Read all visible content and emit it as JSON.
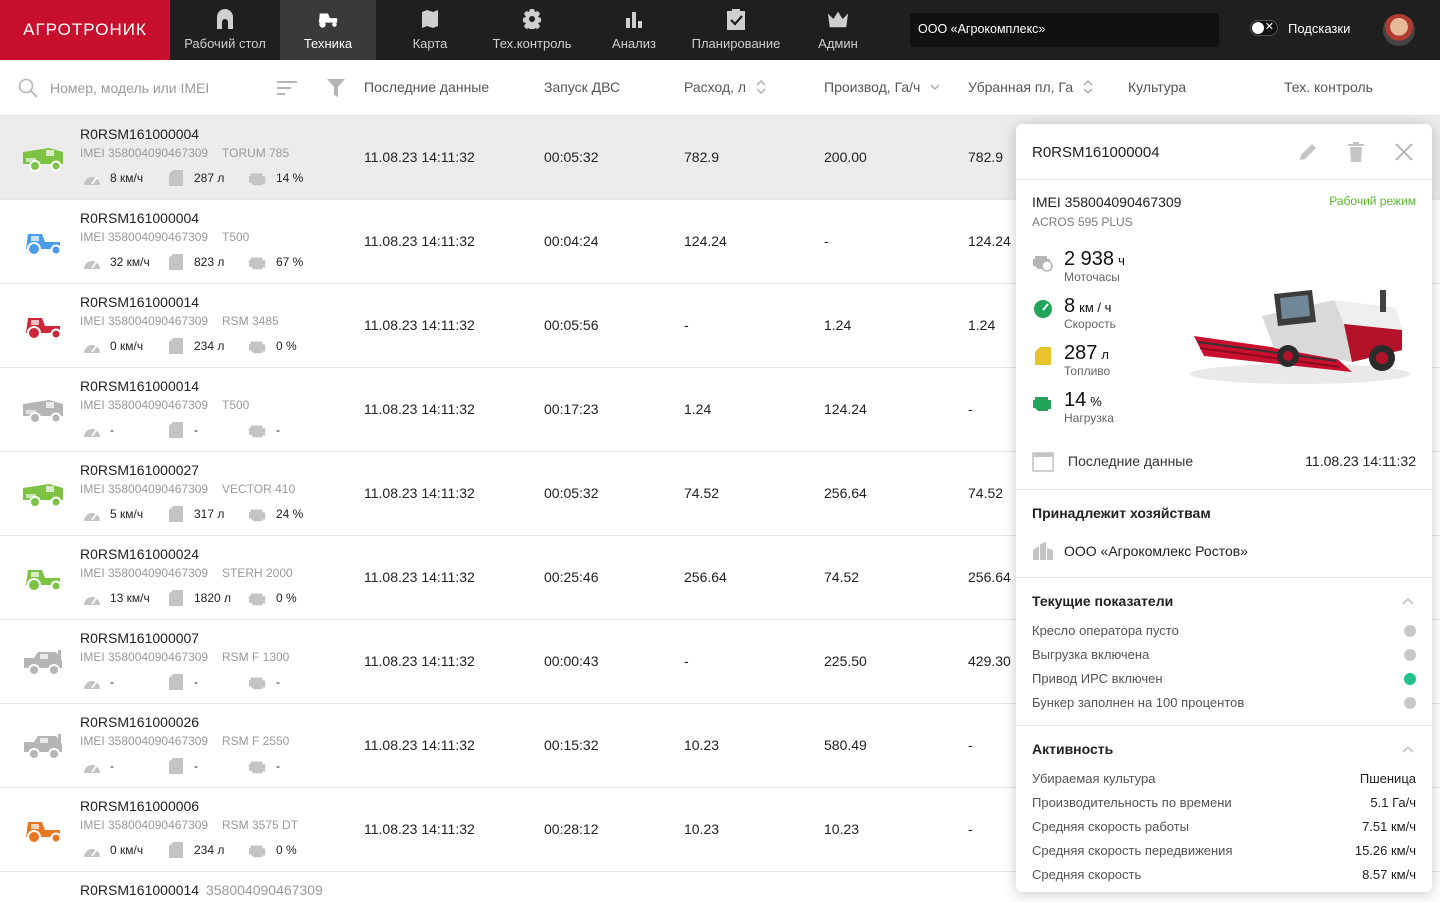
{
  "app": {
    "logo": "АГРОТРОНИК",
    "nav": [
      {
        "label": "Рабочий стол",
        "icon": "home-icon"
      },
      {
        "label": "Техника",
        "icon": "tractor-icon",
        "active": true
      },
      {
        "label": "Карта",
        "icon": "map-icon"
      },
      {
        "label": "Тех.контроль",
        "icon": "gear-icon"
      },
      {
        "label": "Анализ",
        "icon": "bar-chart-icon"
      },
      {
        "label": "Планирование",
        "icon": "clipboard-check-icon"
      },
      {
        "label": "Админ",
        "icon": "crown-icon"
      }
    ],
    "org": "ООО «Агрокомплекс»",
    "hints_label": "Подсказки",
    "hints_toggle_on": false
  },
  "table": {
    "search_placeholder": "Номер, модель или IMEI",
    "columns": [
      "Последние данные",
      "Запуск ДВС",
      "Расход, л",
      "Производ, Га/ч",
      "Убранная пл, Га",
      "Культура",
      "Тех. контроль"
    ],
    "rows": [
      {
        "num": "R0RSM161000004",
        "imei": "IMEI 358004090467309",
        "model": "TORUM 785",
        "speed": "8 км/ч",
        "fuel": "287 л",
        "load": "14 %",
        "last": "11.08.23 14:11:32",
        "engine": "00:05:32",
        "consumption": "782.9",
        "productivity": "200.00",
        "area": "782.9",
        "icon": "combine-icon",
        "color": "#7dc242",
        "selected": true
      },
      {
        "num": "R0RSM161000004",
        "imei": "IMEI 358004090467309",
        "model": "T500",
        "speed": "32 км/ч",
        "fuel": "823 л",
        "load": "67 %",
        "last": "11.08.23 14:11:32",
        "engine": "00:04:24",
        "consumption": "124.24",
        "productivity": "-",
        "area": "124.24",
        "icon": "tractor-icon",
        "color": "#4a9be8"
      },
      {
        "num": "R0RSM161000014",
        "imei": "IMEI 358004090467309",
        "model": "RSM 3485",
        "speed": "0 км/ч",
        "fuel": "234 л",
        "load": "0 %",
        "last": "11.08.23 14:11:32",
        "engine": "00:05:56",
        "consumption": "-",
        "productivity": "1.24",
        "area": "1.24",
        "icon": "tractor-icon",
        "color": "#d0263a"
      },
      {
        "num": "R0RSM161000014",
        "imei": "IMEI 358004090467309",
        "model": "T500",
        "speed": "-",
        "fuel": "-",
        "load": "-",
        "last": "11.08.23 14:11:32",
        "engine": "00:17:23",
        "consumption": "1.24",
        "productivity": "124.24",
        "area": "-",
        "icon": "combine-icon",
        "color": "#b5b5b5"
      },
      {
        "num": "R0RSM161000027",
        "imei": "IMEI 358004090467309",
        "model": "VECTOR 410",
        "speed": "5 км/ч",
        "fuel": "317 л",
        "load": "24 %",
        "last": "11.08.23 14:11:32",
        "engine": "00:05:32",
        "consumption": "74.52",
        "productivity": "256.64",
        "area": "74.52",
        "icon": "combine-icon",
        "color": "#7dc242"
      },
      {
        "num": "R0RSM161000024",
        "imei": "IMEI 358004090467309",
        "model": "STERH 2000",
        "speed": "13 км/ч",
        "fuel": "1820 л",
        "load": "0 %",
        "last": "11.08.23 14:11:32",
        "engine": "00:25:46",
        "consumption": "256.64",
        "productivity": "74.52",
        "area": "256.64",
        "icon": "tractor-icon",
        "color": "#7dc242"
      },
      {
        "num": "R0RSM161000007",
        "imei": "IMEI 358004090467309",
        "model": "RSM F 1300",
        "speed": "-",
        "fuel": "-",
        "load": "-",
        "last": "11.08.23 14:11:32",
        "engine": "00:00:43",
        "consumption": "-",
        "productivity": "225.50",
        "area": "429.30",
        "icon": "harvester-icon",
        "color": "#b5b5b5"
      },
      {
        "num": "R0RSM161000026",
        "imei": "IMEI 358004090467309",
        "model": "RSM F 2550",
        "speed": "-",
        "fuel": "-",
        "load": "-",
        "last": "11.08.23 14:11:32",
        "engine": "00:15:32",
        "consumption": "10.23",
        "productivity": "580.49",
        "area": "-",
        "icon": "harvester-icon",
        "color": "#b5b5b5"
      },
      {
        "num": "R0RSM161000006",
        "imei": "IMEI 358004090467309",
        "model": "RSM 3575 DT",
        "speed": "0 км/ч",
        "fuel": "234 л",
        "load": "0 %",
        "last": "11.08.23 14:11:32",
        "engine": "00:28:12",
        "consumption": "10.23",
        "productivity": "10.23",
        "area": "-",
        "icon": "tractor-icon",
        "color": "#e87722"
      }
    ],
    "last_row": {
      "num": "R0RSM161000014",
      "imei": "358004090467309"
    }
  },
  "panel": {
    "title": "R0RSM161000004",
    "imei": "IMEI 358004090467309",
    "model": "ACROS 595 PLUS",
    "mode": "Рабочий режим",
    "metrics": [
      {
        "value": "2 938",
        "unit": "ч",
        "label": "Моточасы",
        "icon": "engine-hours-icon",
        "color": "#b5b5b5"
      },
      {
        "value": "8",
        "unit": "км / ч",
        "label": "Скорость",
        "icon": "speedometer-icon",
        "color": "#22a55b"
      },
      {
        "value": "287",
        "unit": "л",
        "label": "Топливо",
        "icon": "fuel-icon",
        "color": "#e8c32c"
      },
      {
        "value": "14",
        "unit": "%",
        "label": "Нагрузка",
        "icon": "engine-icon",
        "color": "#22a55b"
      }
    ],
    "last_data_label": "Последние данные",
    "last_data_value": "11.08.23 14:11:32",
    "farms_title": "Принадлежит хозяйствам",
    "farm": "ООО «Агрокомлекс Ростов»",
    "indicators_title": "Текущие показатели",
    "indicators": [
      {
        "label": "Кресло оператора пусто",
        "on": false
      },
      {
        "label": "Выгрузка включена",
        "on": false
      },
      {
        "label": "Привод ИРС включен",
        "on": true
      },
      {
        "label": "Бункер заполнен на 100 процентов",
        "on": false
      }
    ],
    "activity_title": "Активность",
    "activity": [
      {
        "label": "Убираемая культура",
        "value": "Пшеница"
      },
      {
        "label": "Производительность по времени",
        "value": "5.1 Га/ч"
      },
      {
        "label": "Средняя скорость работы",
        "value": "7.51 км/ч"
      },
      {
        "label": "Средняя скорость передвижения",
        "value": "15.26 км/ч"
      },
      {
        "label": "Средняя скорость",
        "value": "8.57 км/ч"
      }
    ]
  }
}
